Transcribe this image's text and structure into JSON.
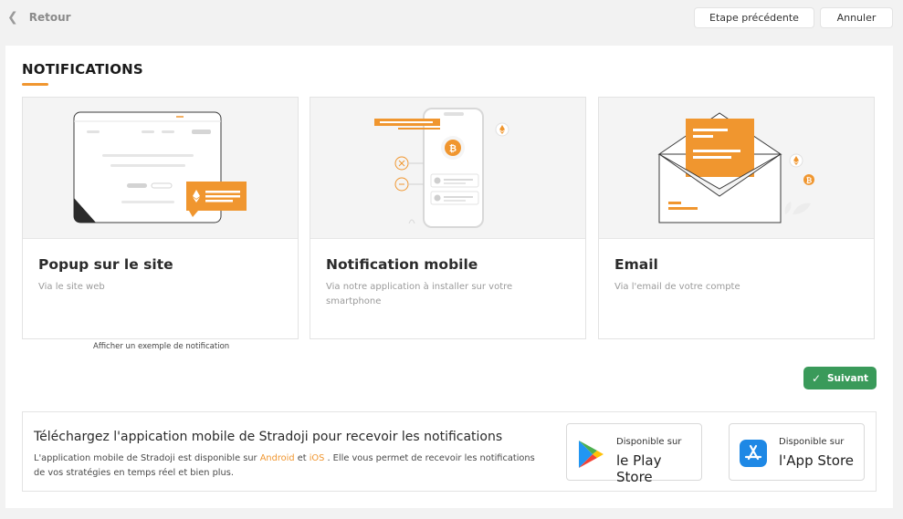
{
  "topbar": {
    "back_label": "Retour",
    "prev_step_label": "Etape précédente",
    "cancel_label": "Annuler"
  },
  "page": {
    "title": "NOTIFICATIONS",
    "accent_color": "#f0962f"
  },
  "cards": [
    {
      "title": "Popup sur le site",
      "description": "Via le site web"
    },
    {
      "title": "Notification mobile",
      "description": "Via notre application à installer sur votre smartphone"
    },
    {
      "title": "Email",
      "description": "Via l'email de votre compte"
    }
  ],
  "example_link": "Afficher un exemple de notification",
  "next_button": {
    "label": "Suivant",
    "icon": "check-icon",
    "color": "#3a9a5a"
  },
  "download": {
    "title": "Téléchargez l'appication mobile de Stradoji pour recevoir les notifications",
    "text_1": "L'application mobile de Stradoji est disponible sur ",
    "android": "Android",
    "text_2": " et ",
    "ios": "iOS",
    "text_3": " . Elle vous permet de recevoir les notifications de vos stratégies en temps réel et bien plus.",
    "play_store": {
      "small": "Disponible sur",
      "big": "le Play Store",
      "icon": "google-play-icon"
    },
    "app_store": {
      "small": "Disponible sur",
      "big": "l'App Store",
      "icon": "app-store-icon"
    }
  }
}
